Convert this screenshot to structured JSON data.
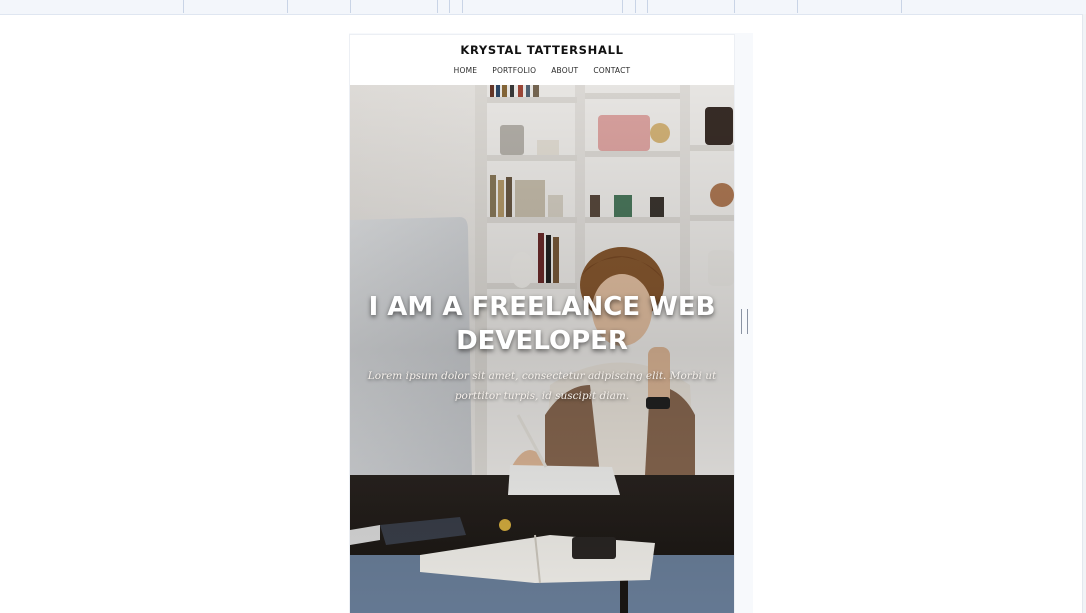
{
  "site": {
    "title": "KRYSTAL TATTERSHALL",
    "nav": [
      "HOME",
      "PORTFOLIO",
      "ABOUT",
      "CONTACT"
    ]
  },
  "hero": {
    "heading": "I AM A FREELANCE WEB DEVELOPER",
    "subtext": "Lorem ipsum dolor sit amet, consectetur adipiscing elit. Morbi ut porttitor turpis, id suscipit diam.",
    "image": "woman-at-desk-photo"
  }
}
